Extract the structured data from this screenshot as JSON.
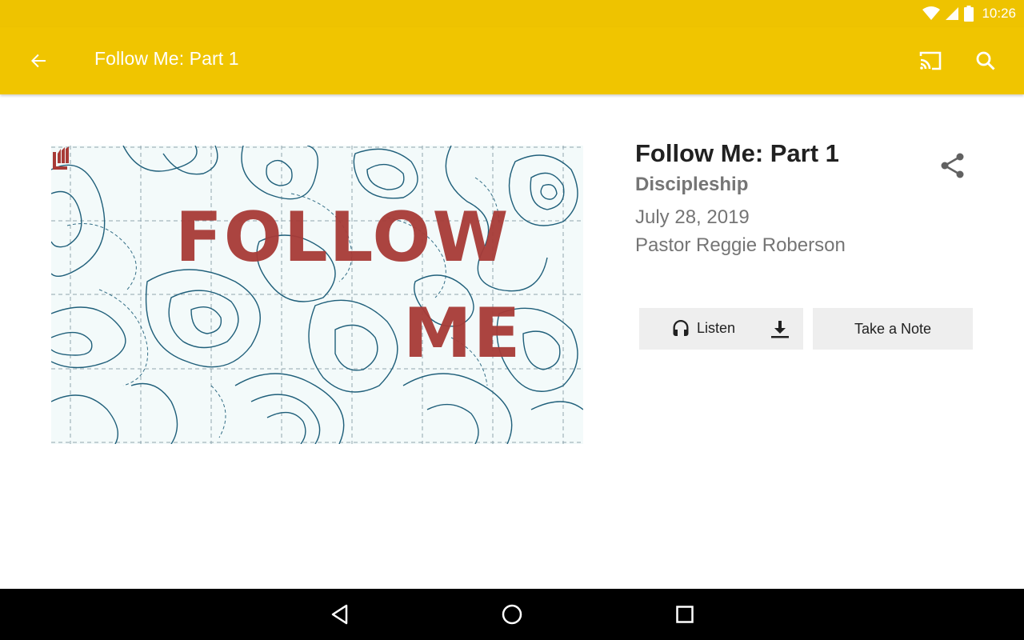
{
  "status_bar": {
    "time": "10:26",
    "icons": [
      "wifi-icon",
      "signal-icon",
      "battery-icon"
    ]
  },
  "app_bar": {
    "title": "Follow Me: Part 1",
    "icons": [
      "back-arrow-icon",
      "cast-icon",
      "search-icon"
    ],
    "color": "#f0c500"
  },
  "artwork": {
    "line1": "FOLLOW",
    "line2": "ME",
    "text_color": "#a83b37",
    "line_color": "#1f5f7a"
  },
  "sermon": {
    "title": "Follow Me: Part 1",
    "series": "Discipleship",
    "date": "July 28, 2019",
    "speaker": "Pastor Reggie Roberson"
  },
  "actions": {
    "listen_label": "Listen",
    "note_label": "Take a Note",
    "icons": [
      "headphones-icon",
      "download-icon",
      "share-icon"
    ]
  },
  "nav_bar": {
    "icons": [
      "nav-back-icon",
      "nav-home-icon",
      "nav-recents-icon"
    ]
  }
}
